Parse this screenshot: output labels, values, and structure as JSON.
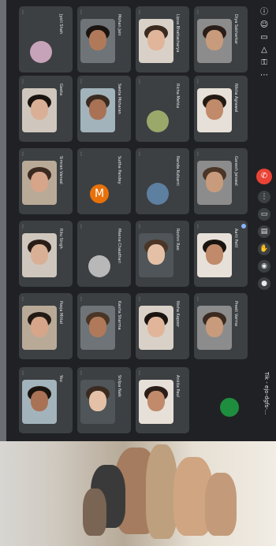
{
  "meeting": {
    "name": "Tik - ejo-dgfs-..."
  },
  "toolbar": {
    "top_icons": [
      "info-icon",
      "people-icon",
      "chat-icon",
      "shapes-icon",
      "lock-icon",
      "more-icon"
    ],
    "controls": [
      {
        "name": "end-call-button",
        "glyph": "✆"
      },
      {
        "name": "more-options-button",
        "glyph": "⋮"
      },
      {
        "name": "present-button",
        "glyph": "▭"
      },
      {
        "name": "captions-button",
        "glyph": "▤"
      },
      {
        "name": "raise-hand-button",
        "glyph": "✋"
      },
      {
        "name": "camera-button",
        "glyph": "◉"
      },
      {
        "name": "mic-button",
        "glyph": "🎤"
      }
    ]
  },
  "participants": [
    {
      "name": "Diya Sakharkar"
    },
    {
      "name": "Lipsa Bhattacharya"
    },
    {
      "name": "Mohan Jain"
    },
    {
      "name": "Jyoti Shah"
    },
    {
      "name": "Nikita Agrawal"
    },
    {
      "name": "Richa Mehta"
    },
    {
      "name": "Sweta Moharan"
    },
    {
      "name": "Geeta"
    },
    {
      "name": "Ganesh Jaiswal"
    },
    {
      "name": "Nanda Kulkarni"
    },
    {
      "name": "Sudha Pandey"
    },
    {
      "name": "Simran Vansal"
    },
    {
      "name": "Aarti Patil"
    },
    {
      "name": "Roshni Rao"
    },
    {
      "name": "Meena Chaudhari"
    },
    {
      "name": "Ritu Singh"
    },
    {
      "name": "Preeti Varma"
    },
    {
      "name": "Nisha Kapoor"
    },
    {
      "name": "Kavita Sharma"
    },
    {
      "name": "Pooja Mittal"
    },
    {
      "name": "Ankita Paul"
    },
    {
      "name": "Shilpa Naik"
    },
    {
      "name": "You"
    }
  ]
}
